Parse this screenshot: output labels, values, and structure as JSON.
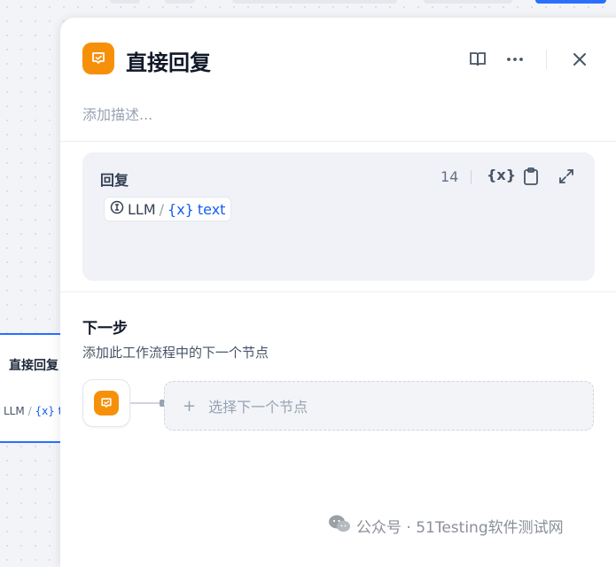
{
  "panel": {
    "title": "直接回复",
    "description_placeholder": "添加描述...",
    "icons": {
      "node": "reply-node-icon",
      "doc": "book-open-icon",
      "more": "more-dots-icon",
      "close": "close-icon"
    }
  },
  "reply": {
    "label": "回复",
    "count": "14",
    "var_button": "{x}",
    "tools": [
      "variable-insert-icon",
      "clipboard-icon",
      "expand-icon"
    ],
    "chip": {
      "source": "LLM",
      "separator": "/",
      "var_icon": "{x}",
      "var_name": "text"
    }
  },
  "next_step": {
    "title": "下一步",
    "description": "添加此工作流程中的下一个节点",
    "select_label": "选择下一个节点",
    "plus": "+"
  },
  "background_node": {
    "title": "直接回复",
    "source": "LLM",
    "separator": "/",
    "var": "{x} te"
  },
  "watermark": {
    "text": "公众号 · 51Testing软件测试网"
  },
  "colors": {
    "accent_orange": "#f79009",
    "accent_blue": "#155eef",
    "panel_bg": "#ffffff",
    "reply_box_bg": "#f0f2f7"
  }
}
